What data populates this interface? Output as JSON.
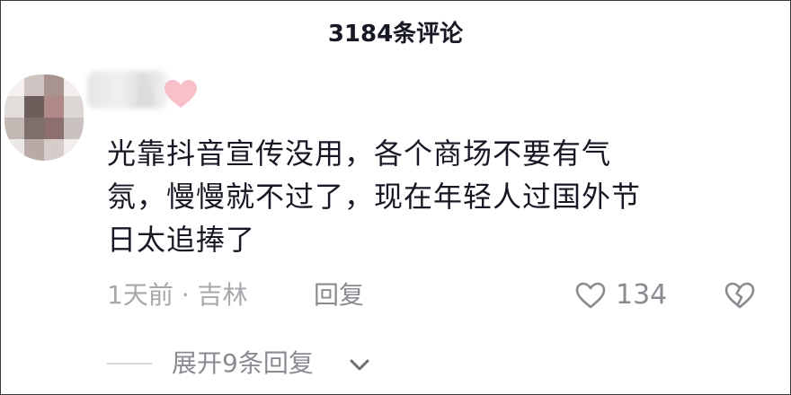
{
  "header": {
    "title": "3184条评论"
  },
  "comment": {
    "text_line1": "光靠抖音宣传没用，各个商场不要有气",
    "text_line2": "氛，慢慢就不过了，现在年轻人过国外节",
    "text_line3": "日太追捧了",
    "time_location": "1天前 · 吉林",
    "reply_label": "回复",
    "like_count": "134",
    "expand_label": "展开9条回复"
  },
  "colors": {
    "text_primary": "#161823",
    "text_secondary": "#8a8b91",
    "text_tertiary": "#a7a8ab",
    "heart_badge": "#f7b6c0"
  },
  "icons": {
    "like": "heart-outline-icon",
    "dislike": "broken-heart-icon",
    "expand": "chevron-down-icon",
    "badge": "pink-heart-icon"
  }
}
